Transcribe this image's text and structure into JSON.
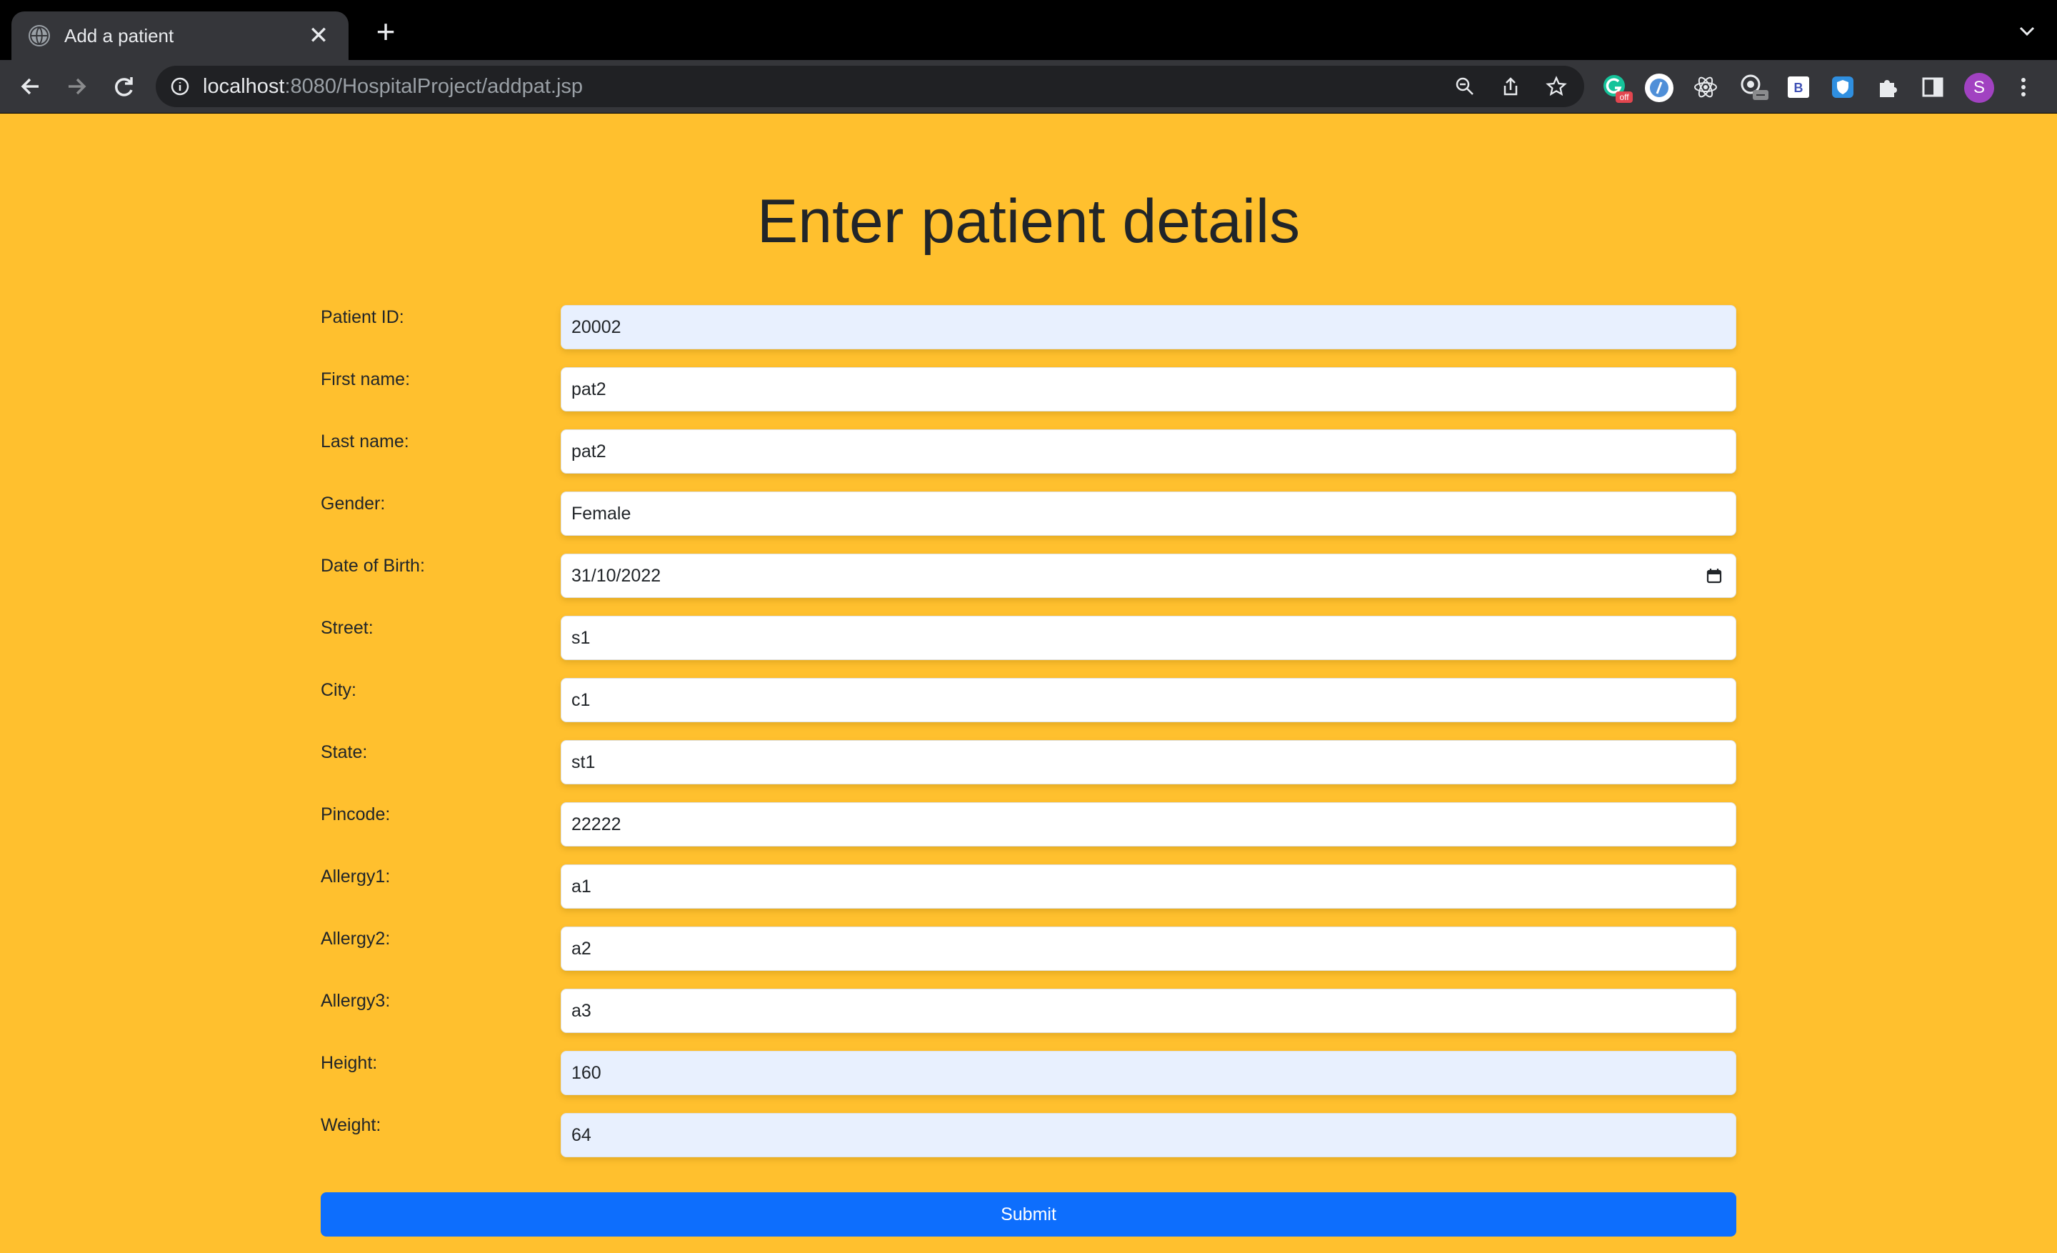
{
  "browser": {
    "tab_title": "Add a patient",
    "tab_close": "✕",
    "new_tab": "+",
    "url_host": "localhost",
    "url_rest": ":8080/HospitalProject/addpat.jsp",
    "profile_initial": "S",
    "extension_badge": "off",
    "extension_b_label": "B"
  },
  "page": {
    "heading": "Enter patient details",
    "fields": [
      {
        "label": "Patient ID:",
        "value": "20002",
        "autofill": true
      },
      {
        "label": "First name:",
        "value": "pat2",
        "autofill": false
      },
      {
        "label": "Last name:",
        "value": "pat2",
        "autofill": false
      },
      {
        "label": "Gender:",
        "value": "Female",
        "autofill": false
      },
      {
        "label": "Date of Birth:",
        "value": "31/10/2022",
        "autofill": false
      },
      {
        "label": "Street:",
        "value": "s1",
        "autofill": false
      },
      {
        "label": "City:",
        "value": "c1",
        "autofill": false
      },
      {
        "label": "State:",
        "value": "st1",
        "autofill": false
      },
      {
        "label": "Pincode:",
        "value": "22222",
        "autofill": false
      },
      {
        "label": "Allergy1:",
        "value": "a1",
        "autofill": false
      },
      {
        "label": "Allergy2:",
        "value": "a2",
        "autofill": false
      },
      {
        "label": "Allergy3:",
        "value": "a3",
        "autofill": false
      },
      {
        "label": "Height:",
        "value": "160",
        "autofill": true
      },
      {
        "label": "Weight:",
        "value": "64",
        "autofill": true
      }
    ],
    "submit_label": "Submit"
  },
  "colors": {
    "page_background": "#ffc02e",
    "submit_background": "#0d6efd",
    "autofill_background": "#e8f0fe"
  }
}
